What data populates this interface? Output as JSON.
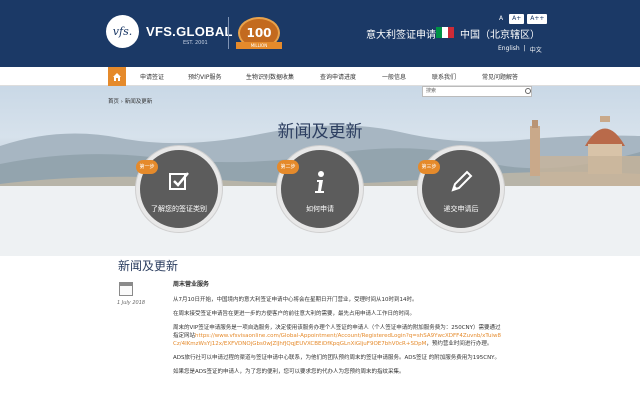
{
  "header": {
    "logo_text": "vfs.",
    "brand": "VFS.GLOBAL",
    "brand_sub": "EST. 2001",
    "badge_number": "100",
    "badge_ribbon": "MILLION",
    "title": "意大利签证申请",
    "country": "中国（北京辖区）",
    "font_sizes": [
      "A",
      "A+",
      "A++"
    ],
    "languages": [
      "English",
      "|",
      "中文"
    ],
    "flag_colors": [
      "#009246",
      "#ffffff",
      "#ce2b37"
    ]
  },
  "nav": {
    "items": [
      "申请签证",
      "预约VIP服务",
      "生物识别数据收集",
      "查询申请进度",
      "一般信息",
      "联系我们",
      "常见问题解答"
    ]
  },
  "hero": {
    "breadcrumb": "首页 › 新闻及更新",
    "search_placeholder": "搜索",
    "title": "新闻及更新",
    "steps": [
      {
        "step": "第一步",
        "label": "了解您的签证类别",
        "icon": "checkbox-icon"
      },
      {
        "step": "第二步",
        "label": "如何申请",
        "icon": "info-icon"
      },
      {
        "step": "第三步",
        "label": "递交申请后",
        "icon": "pencil-icon"
      }
    ]
  },
  "content": {
    "section_title": "新闻及更新",
    "date": "1 July 2018",
    "article_title": "周末营业服务",
    "paragraphs": [
      "从7月10日开始，中国境内的意大利签证申请中心将会在星期日开门营业，受理时间从10时到14时。",
      "在周末接受签证申请旨在更进一步的方便客户的前往意大利的需要，最先占用申请人工作日的时间。",
      "周末的VIP签证申请服务是一项自选服务，决定使用该服务办理个人签证的申请人（个人签证申请的附加服务费为：250CNY）需要通过指定网站",
      "https://www.vfsvisaonline.com/Global-Appointment/Account/RegisteredLogin?q=shSA9YwcXDFF4Zuvnb/xTuiw8Cz/4IKmzWsYj12x/EXFVDNOjGbs0wJZlJhfJQqjEUVXCBEiDfKpqGLnXiGIjuF9OE7bhV0cR+SDpM",
      "，预约营业时间进行办理。",
      "ADS旅行社可以申请过程的渠道与签证申请中心联系，为他们的团队预约周末的签证申请服务。ADS签证 的附加服务费用为195CNY。",
      "如果您是ADS签证的申请人，为了您的便利，您可以要求您的代办人为您预约周末的指纹采集。"
    ]
  },
  "colors": {
    "header_bg": "#1b3966",
    "accent": "#e58a2b",
    "circle": "#5c5c5c"
  }
}
